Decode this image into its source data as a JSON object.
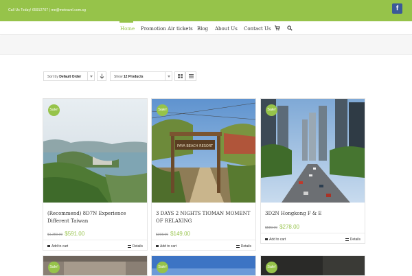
{
  "topbar": {
    "contact": "Call Us Today! 65912707 | me@metravel.com.sg",
    "facebook_icon": "f"
  },
  "nav": {
    "items": [
      "Home",
      "Promotion Air tickets",
      "Blog",
      "About Us",
      "Contact Us"
    ],
    "active": "Home",
    "icons": [
      "cart-icon",
      "search-icon"
    ]
  },
  "toolbar": {
    "sort_prefix": "Sort by",
    "sort_value": "Default Order",
    "show_prefix": "Show",
    "show_value": "12 Products"
  },
  "sale_badge": "Sale!",
  "products": [
    {
      "title": "(Recommend) 8D7N Experience Different Taiwan",
      "old_price": "$1,350.00",
      "new_price": "$591.00",
      "add_to_cart": "Add to cart",
      "details": "Details"
    },
    {
      "title": "3 DAYS 2 NIGHTS TIOMAN MOMENT OF RELAXING",
      "old_price": "$398.00",
      "new_price": "$149.00",
      "add_to_cart": "Add to cart",
      "details": "Details"
    },
    {
      "title": "3D2N Hongkong F & E",
      "old_price": "$580.00",
      "new_price": "$278.00",
      "add_to_cart": "Add to cart",
      "details": "Details"
    }
  ],
  "sign_text": "PAYA BEACH RESORT",
  "colors": {
    "accent": "#96c34a",
    "facebook": "#3b5998"
  }
}
